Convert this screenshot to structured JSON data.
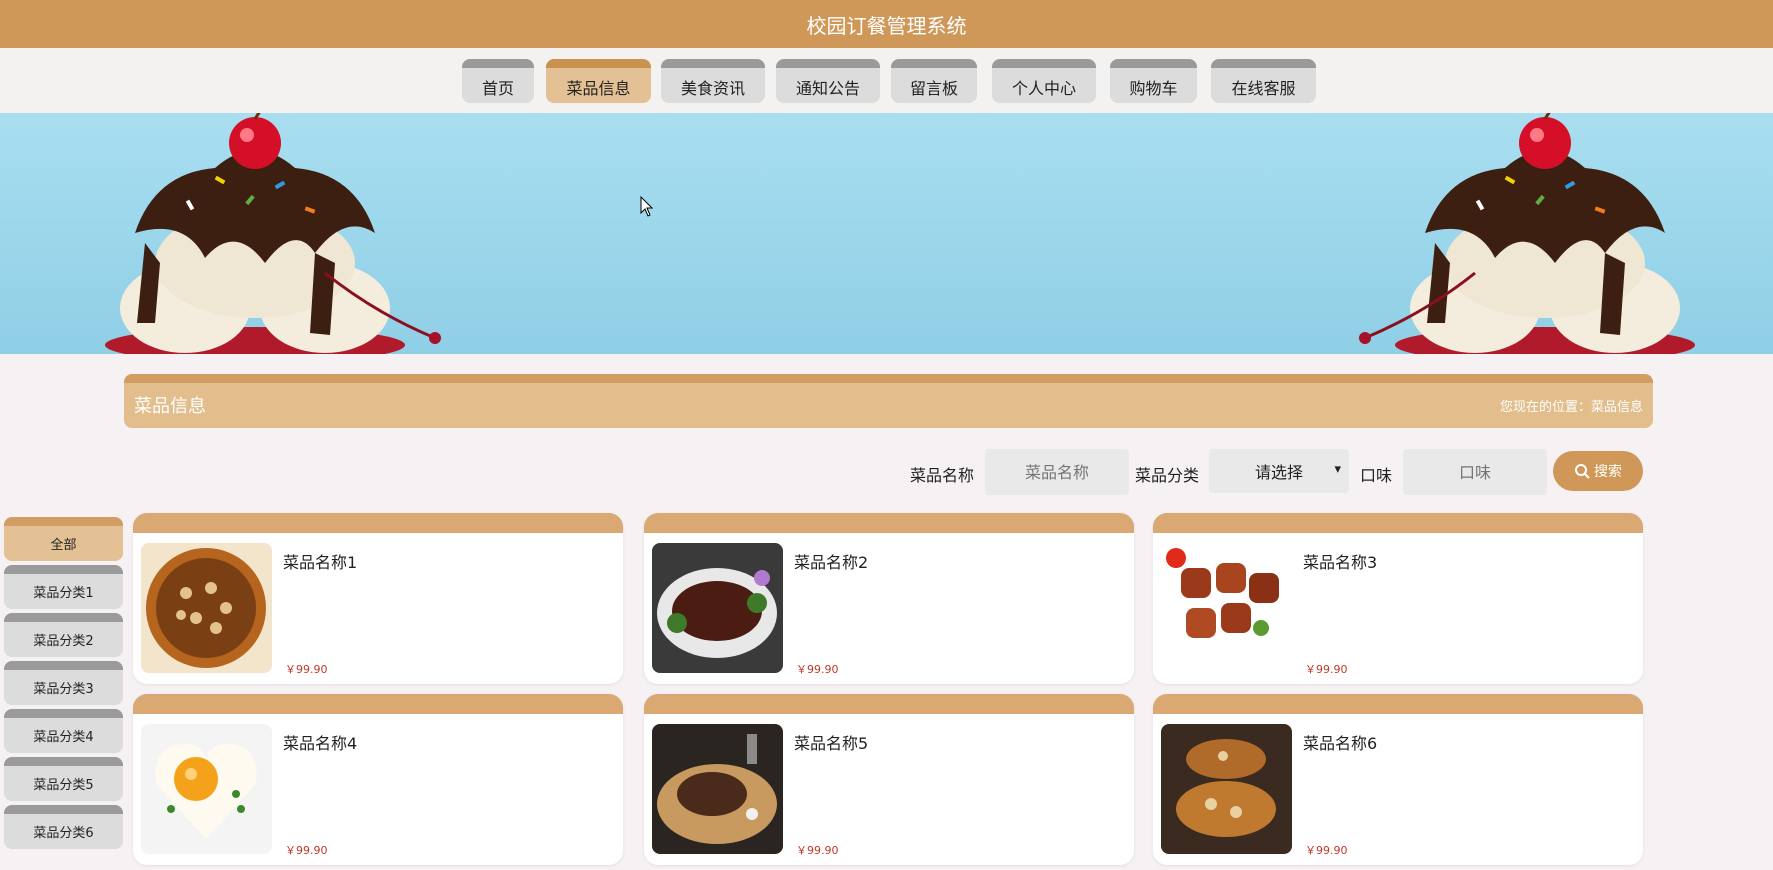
{
  "header": {
    "title": "校园订餐管理系统"
  },
  "nav": {
    "items": [
      {
        "label": "首页"
      },
      {
        "label": "菜品信息"
      },
      {
        "label": "美食资讯"
      },
      {
        "label": "通知公告"
      },
      {
        "label": "留言板"
      },
      {
        "label": "个人中心"
      },
      {
        "label": "购物车"
      },
      {
        "label": "在线客服"
      }
    ],
    "active_index": 1
  },
  "section": {
    "title": "菜品信息",
    "breadcrumb": "您现在的位置：菜品信息"
  },
  "search": {
    "name_label": "菜品名称",
    "name_placeholder": "菜品名称",
    "category_label": "菜品分类",
    "category_value": "请选择",
    "taste_label": "口味",
    "taste_placeholder": "口味",
    "button_label": "搜索"
  },
  "categories": [
    {
      "label": "全部"
    },
    {
      "label": "菜品分类1"
    },
    {
      "label": "菜品分类2"
    },
    {
      "label": "菜品分类3"
    },
    {
      "label": "菜品分类4"
    },
    {
      "label": "菜品分类5"
    },
    {
      "label": "菜品分类6"
    }
  ],
  "dishes": [
    {
      "name": "菜品名称1",
      "price": "￥99.90"
    },
    {
      "name": "菜品名称2",
      "price": "￥99.90"
    },
    {
      "name": "菜品名称3",
      "price": "￥99.90"
    },
    {
      "name": "菜品名称4",
      "price": "￥99.90"
    },
    {
      "name": "菜品名称5",
      "price": "￥99.90"
    },
    {
      "name": "菜品名称6",
      "price": "￥99.90"
    }
  ],
  "colors": {
    "brand": "#d09858",
    "price": "#c0392b"
  }
}
